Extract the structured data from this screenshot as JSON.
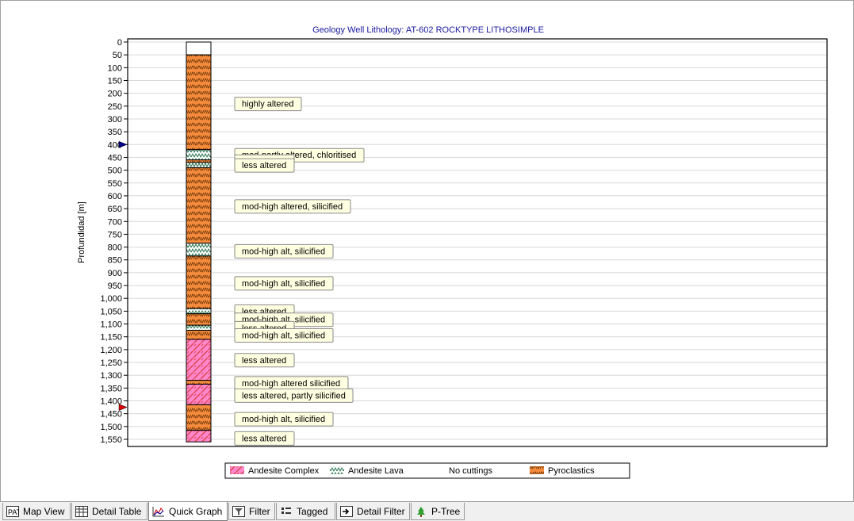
{
  "chart_data": {
    "type": "well-lithology-log",
    "title": "Geology Well Lithology:  AT-602 ROCKTYPE LITHOSIMPLE",
    "ylabel": "Profundidad [m]",
    "ylim": [
      0,
      1570
    ],
    "y_ticks": [
      "0",
      "50",
      "100",
      "150",
      "200",
      "250",
      "300",
      "350",
      "400",
      "450",
      "500",
      "550",
      "600",
      "650",
      "700",
      "750",
      "800",
      "850",
      "900",
      "950",
      "1,000",
      "1,050",
      "1,100",
      "1,150",
      "1,200",
      "1,250",
      "1,300",
      "1,350",
      "1,400",
      "1,450",
      "1,500",
      "1,550"
    ],
    "y_tick_values": [
      0,
      50,
      100,
      150,
      200,
      250,
      300,
      350,
      400,
      450,
      500,
      550,
      600,
      650,
      700,
      750,
      800,
      850,
      900,
      950,
      1000,
      1050,
      1100,
      1150,
      1200,
      1250,
      1300,
      1350,
      1400,
      1450,
      1500,
      1550
    ],
    "grid": true,
    "intervals": [
      {
        "top": 0,
        "bottom": 50,
        "rock": "No cuttings"
      },
      {
        "top": 50,
        "bottom": 420,
        "rock": "Pyroclastics"
      },
      {
        "top": 420,
        "bottom": 460,
        "rock": "Andesite Lava"
      },
      {
        "top": 460,
        "bottom": 470,
        "rock": "Pyroclastics"
      },
      {
        "top": 470,
        "bottom": 490,
        "rock": "Andesite Lava"
      },
      {
        "top": 490,
        "bottom": 785,
        "rock": "Pyroclastics"
      },
      {
        "top": 785,
        "bottom": 835,
        "rock": "Andesite Lava"
      },
      {
        "top": 835,
        "bottom": 1040,
        "rock": "Pyroclastics"
      },
      {
        "top": 1040,
        "bottom": 1060,
        "rock": "Andesite Lava"
      },
      {
        "top": 1060,
        "bottom": 1105,
        "rock": "Pyroclastics"
      },
      {
        "top": 1105,
        "bottom": 1125,
        "rock": "Andesite Lava"
      },
      {
        "top": 1125,
        "bottom": 1160,
        "rock": "Pyroclastics"
      },
      {
        "top": 1160,
        "bottom": 1320,
        "rock": "Andesite Complex"
      },
      {
        "top": 1320,
        "bottom": 1335,
        "rock": "Pyroclastics"
      },
      {
        "top": 1335,
        "bottom": 1415,
        "rock": "Andesite Complex"
      },
      {
        "top": 1415,
        "bottom": 1515,
        "rock": "Pyroclastics"
      },
      {
        "top": 1515,
        "bottom": 1560,
        "rock": "Andesite Complex"
      }
    ],
    "annotations": [
      {
        "depth": 240,
        "text": "highly altered"
      },
      {
        "depth": 440,
        "text": "mod-partly altered, chloritised"
      },
      {
        "depth": 465,
        "text": "less altered"
      },
      {
        "depth": 480,
        "text": "less altered"
      },
      {
        "depth": 640,
        "text": "mod-high altered, silicified"
      },
      {
        "depth": 815,
        "text": "mod-high alt, silicified"
      },
      {
        "depth": 940,
        "text": "mod-high alt, silicified"
      },
      {
        "depth": 1050,
        "text": "less altered"
      },
      {
        "depth": 1082,
        "text": "mod-high alt, silicified"
      },
      {
        "depth": 1115,
        "text": "less altered"
      },
      {
        "depth": 1143,
        "text": "mod-high alt, silicified"
      },
      {
        "depth": 1240,
        "text": "less altered"
      },
      {
        "depth": 1330,
        "text": "mod-high altered silicified"
      },
      {
        "depth": 1378,
        "text": "less altered, partly silicified"
      },
      {
        "depth": 1470,
        "text": "mod-high alt, silicified"
      },
      {
        "depth": 1545,
        "text": "less altered"
      }
    ],
    "markers": [
      {
        "depth": 400,
        "color": "#00008b"
      },
      {
        "depth": 1425,
        "color": "#dd0000"
      }
    ],
    "legend": {
      "placement": "bottom",
      "entries": [
        {
          "name": "Andesite Complex",
          "pattern": "andesite-complex"
        },
        {
          "name": "Andesite Lava",
          "pattern": "andesite-lava"
        },
        {
          "name": "No cuttings",
          "pattern": "none"
        },
        {
          "name": "Pyroclastics",
          "pattern": "pyroclastics"
        }
      ]
    },
    "colors": {
      "pyroclastics": "#f58b3c",
      "andesite_complex": "#ff88cc",
      "andesite_lava": "#ffffff",
      "title": "#1a1aa0",
      "label_bg": "#ffffe1"
    }
  },
  "tabs": [
    {
      "label": "Map View",
      "icon": "map-view-icon",
      "active": false
    },
    {
      "label": "Detail Table",
      "icon": "table-icon",
      "active": false
    },
    {
      "label": "Quick Graph",
      "icon": "graph-icon",
      "active": true
    },
    {
      "label": "Filter",
      "icon": "filter-icon",
      "active": false
    },
    {
      "label": "Tagged",
      "icon": "tagged-icon",
      "active": false
    },
    {
      "label": "Detail Filter",
      "icon": "detail-filter-icon",
      "active": false
    },
    {
      "label": "P-Tree",
      "icon": "tree-icon",
      "active": false
    }
  ]
}
